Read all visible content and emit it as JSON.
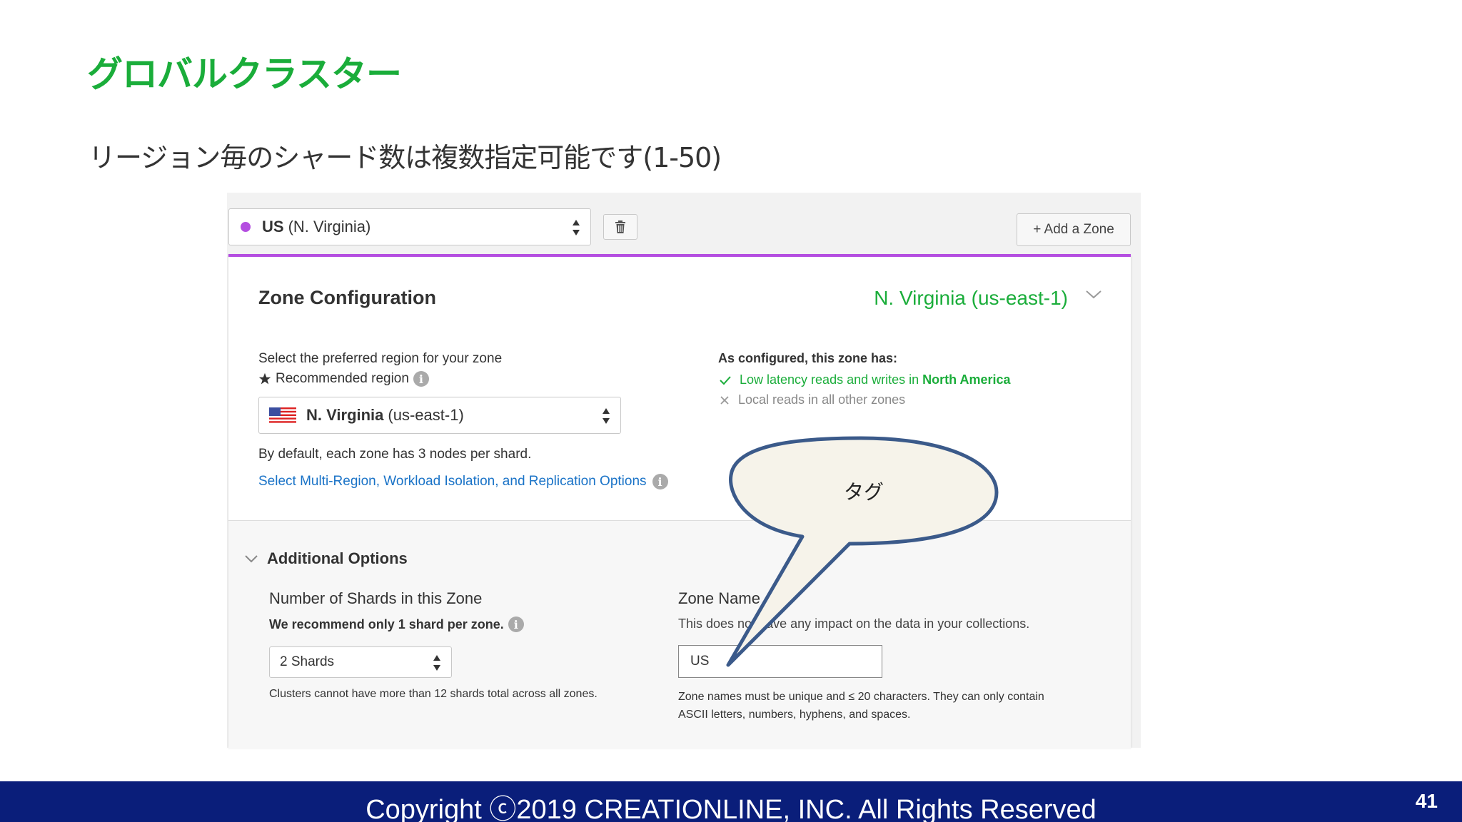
{
  "slide": {
    "title": "グロバルクラスター",
    "subtitle": "リージョン毎のシャード数は複数指定可能です(1-50)"
  },
  "topbar": {
    "region_code": "US",
    "region_name": "(N. Virginia)",
    "add_zone_label": "+ Add a Zone"
  },
  "zone_config": {
    "title": "Zone Configuration",
    "region_display": "N. Virginia (us-east-1)",
    "preferred_label": "Select the preferred region for your zone",
    "recommended_label": "Recommended region",
    "selected_region_bold": "N. Virginia",
    "selected_region_code": "(us-east-1)",
    "default_text": "By default, each zone has 3 nodes per shard.",
    "multi_region_link": "Select Multi-Region, Workload Isolation, and Replication Options",
    "configured_title": "As configured, this zone has:",
    "capability_1_prefix": "Low latency reads and writes in",
    "capability_1_region": "North America",
    "capability_2": "Local reads in all other zones"
  },
  "additional_options": {
    "title": "Additional Options",
    "shards_label": "Number of Shards in this Zone",
    "shards_recommend": "We recommend only 1 shard per zone.",
    "shards_value": "2 Shards",
    "shards_note": "Clusters cannot have more than 12 shards total across all zones.",
    "zone_name_label": "Zone Name",
    "zone_name_desc": "This does not have any impact on the data in your collections.",
    "zone_name_value": "US",
    "zone_name_note": "Zone names must be unique and ≤ 20 characters. They can only contain ASCII letters, numbers, hyphens, and spaces."
  },
  "callout": {
    "text": "タグ"
  },
  "footer": {
    "copyright": "Copyright ⓒ2019 CREATIONLINE, INC. All Rights Reserved",
    "page_number": "41"
  },
  "colors": {
    "accent_green": "#1aad3a",
    "zone_purple": "#b44ee0",
    "link_blue": "#1a73c7",
    "footer_navy": "#0a1e7a"
  }
}
